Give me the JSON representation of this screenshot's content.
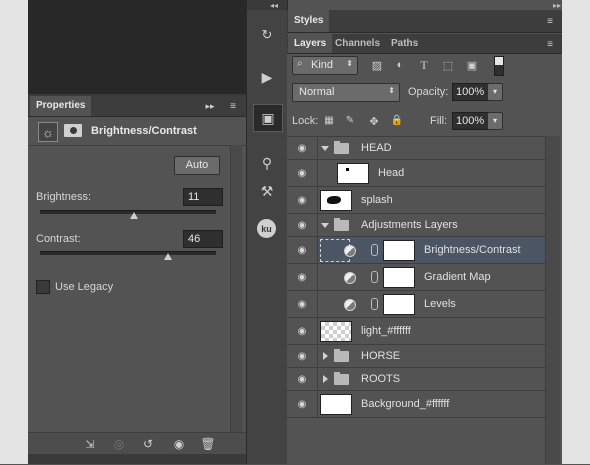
{
  "properties": {
    "title": "Properties",
    "adjustment_name": "Brightness/Contrast",
    "auto_label": "Auto",
    "brightness_label": "Brightness:",
    "brightness_value": "11",
    "contrast_label": "Contrast:",
    "contrast_value": "46",
    "use_legacy_label": "Use Legacy"
  },
  "styles_panel": {
    "title": "Styles"
  },
  "layers_panel": {
    "tabs": [
      "Layers",
      "Channels",
      "Paths"
    ],
    "filter_kind": "Kind",
    "blend_mode": "Normal",
    "opacity_label": "Opacity:",
    "opacity_value": "100%",
    "lock_label": "Lock:",
    "fill_label": "Fill:",
    "fill_value": "100%",
    "layers": [
      {
        "name": "HEAD"
      },
      {
        "name": "Head"
      },
      {
        "name": "splash"
      },
      {
        "name": "Adjustments Layers"
      },
      {
        "name": "Brightness/Contrast"
      },
      {
        "name": "Gradient Map"
      },
      {
        "name": "Levels"
      },
      {
        "name": "light_#ffffff"
      },
      {
        "name": "HORSE"
      },
      {
        "name": "ROOTS"
      },
      {
        "name": "Background_#ffffff"
      }
    ]
  },
  "toolbar_icons": {
    "ku_label": "ku"
  }
}
